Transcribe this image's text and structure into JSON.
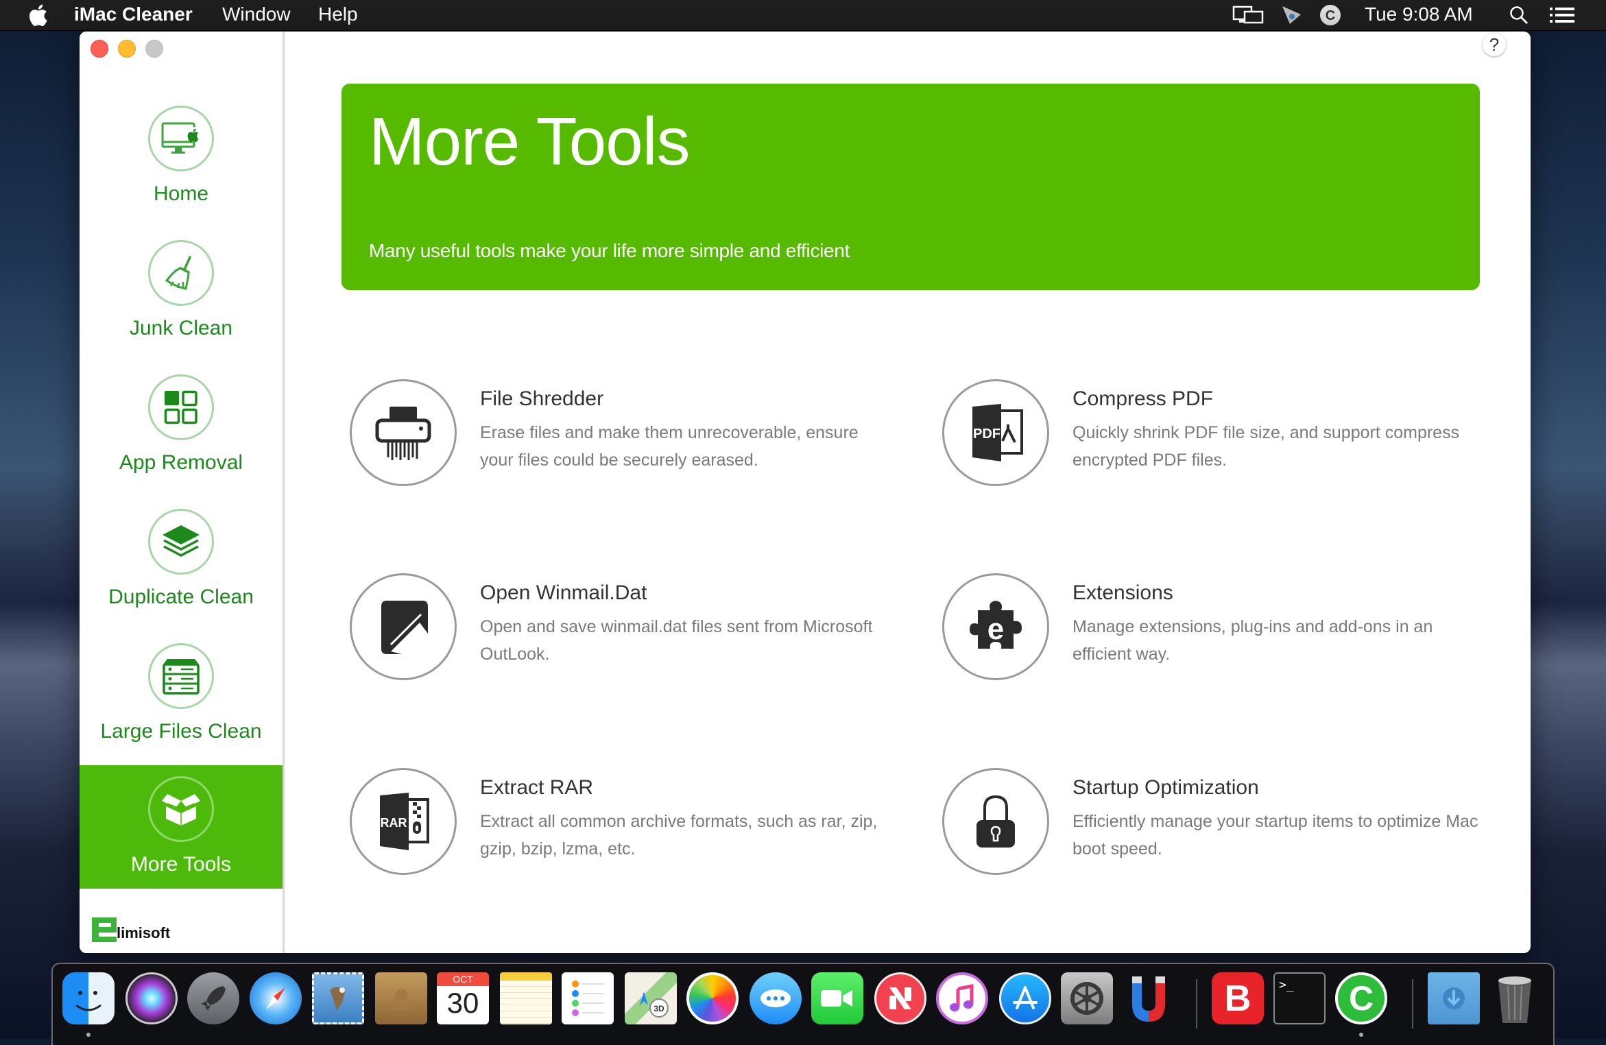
{
  "menubar": {
    "app_name": "iMac Cleaner",
    "menus": [
      "Window",
      "Help"
    ],
    "clock": "Tue 9:08 AM",
    "status_icons": [
      "display-mirroring-icon",
      "screen-capture-icon",
      "ccleaner-status-icon",
      "spotlight-search-icon",
      "notification-center-icon"
    ]
  },
  "window": {
    "controls": [
      "close",
      "minimize",
      "zoom"
    ],
    "help_label": "?"
  },
  "sidebar": {
    "items": [
      {
        "label": "Home",
        "icon": "imac-apple-icon",
        "active": false
      },
      {
        "label": "Junk Clean",
        "icon": "broom-icon",
        "active": false
      },
      {
        "label": "App Removal",
        "icon": "app-grid-icon",
        "active": false
      },
      {
        "label": "Duplicate Clean",
        "icon": "layers-icon",
        "active": false
      },
      {
        "label": "Large Files Clean",
        "icon": "server-drawers-icon",
        "active": false
      },
      {
        "label": "More Tools",
        "icon": "open-box-icon",
        "active": true
      }
    ],
    "logo_text": "limisoft"
  },
  "banner": {
    "title": "More Tools",
    "subtitle": "Many useful tools make your life more simple and efficient"
  },
  "tools": [
    {
      "title": "File Shredder",
      "desc": "Erase files and make them unrecoverable, ensure your files could be securely earased.",
      "icon": "shredder-icon"
    },
    {
      "title": "Compress PDF",
      "desc": "Quickly shrink PDF file size, and support compress encrypted PDF files.",
      "icon": "pdf-file-icon",
      "icon_text": "PDF"
    },
    {
      "title": "Open Winmail.Dat",
      "desc": "Open and save winmail.dat files sent from Microsoft OutLook.",
      "icon": "open-external-icon"
    },
    {
      "title": "Extensions",
      "desc": "Manage extensions, plug-ins and add-ons in an efficient way.",
      "icon": "puzzle-extension-icon",
      "icon_text": "e"
    },
    {
      "title": "Extract RAR",
      "desc": "Extract all common archive formats, such as rar, zip, gzip, bzip, lzma, etc.",
      "icon": "rar-archive-icon",
      "icon_text": "RAR"
    },
    {
      "title": "Startup Optimization",
      "desc": "Efficiently manage your startup items to optimize Mac boot speed.",
      "icon": "padlock-icon"
    }
  ],
  "dock": {
    "items": [
      {
        "name": "Finder",
        "icon": "finder-icon",
        "running": true
      },
      {
        "name": "Siri",
        "icon": "siri-icon"
      },
      {
        "name": "Launchpad",
        "icon": "launchpad-rocket-icon"
      },
      {
        "name": "Safari",
        "icon": "safari-compass-icon"
      },
      {
        "name": "Mail",
        "icon": "mail-stamp-icon"
      },
      {
        "name": "Contacts",
        "icon": "contacts-book-icon"
      },
      {
        "name": "Calendar",
        "icon": "calendar-icon",
        "month": "OCT",
        "day": "30"
      },
      {
        "name": "Notes",
        "icon": "notes-icon"
      },
      {
        "name": "Reminders",
        "icon": "reminders-icon"
      },
      {
        "name": "Maps",
        "icon": "maps-icon",
        "badge": "3D"
      },
      {
        "name": "Photos",
        "icon": "photos-icon"
      },
      {
        "name": "Messages",
        "icon": "messages-icon"
      },
      {
        "name": "FaceTime",
        "icon": "facetime-icon"
      },
      {
        "name": "News",
        "icon": "news-icon"
      },
      {
        "name": "iTunes",
        "icon": "itunes-music-icon"
      },
      {
        "name": "App Store",
        "icon": "app-store-icon"
      },
      {
        "name": "System Preferences",
        "icon": "system-preferences-gear-icon"
      },
      {
        "name": "Magnet",
        "icon": "magnet-icon"
      },
      {
        "name": "Bitdefender",
        "icon": "bitdefender-b-icon",
        "letter": "B"
      },
      {
        "name": "Terminal",
        "icon": "terminal-icon",
        "text": ">_"
      },
      {
        "name": "CCleaner",
        "icon": "ccleaner-icon",
        "letter": "C",
        "running": true
      },
      {
        "name": "Downloads",
        "icon": "downloads-folder-icon"
      },
      {
        "name": "Trash",
        "icon": "trash-icon"
      }
    ]
  },
  "colors": {
    "accent_green": "#56bb00",
    "sidebar_active": "#4dba0b",
    "sidebar_text": "#1b8a1b",
    "tool_title": "#333333",
    "tool_desc": "#7a7a7a"
  }
}
